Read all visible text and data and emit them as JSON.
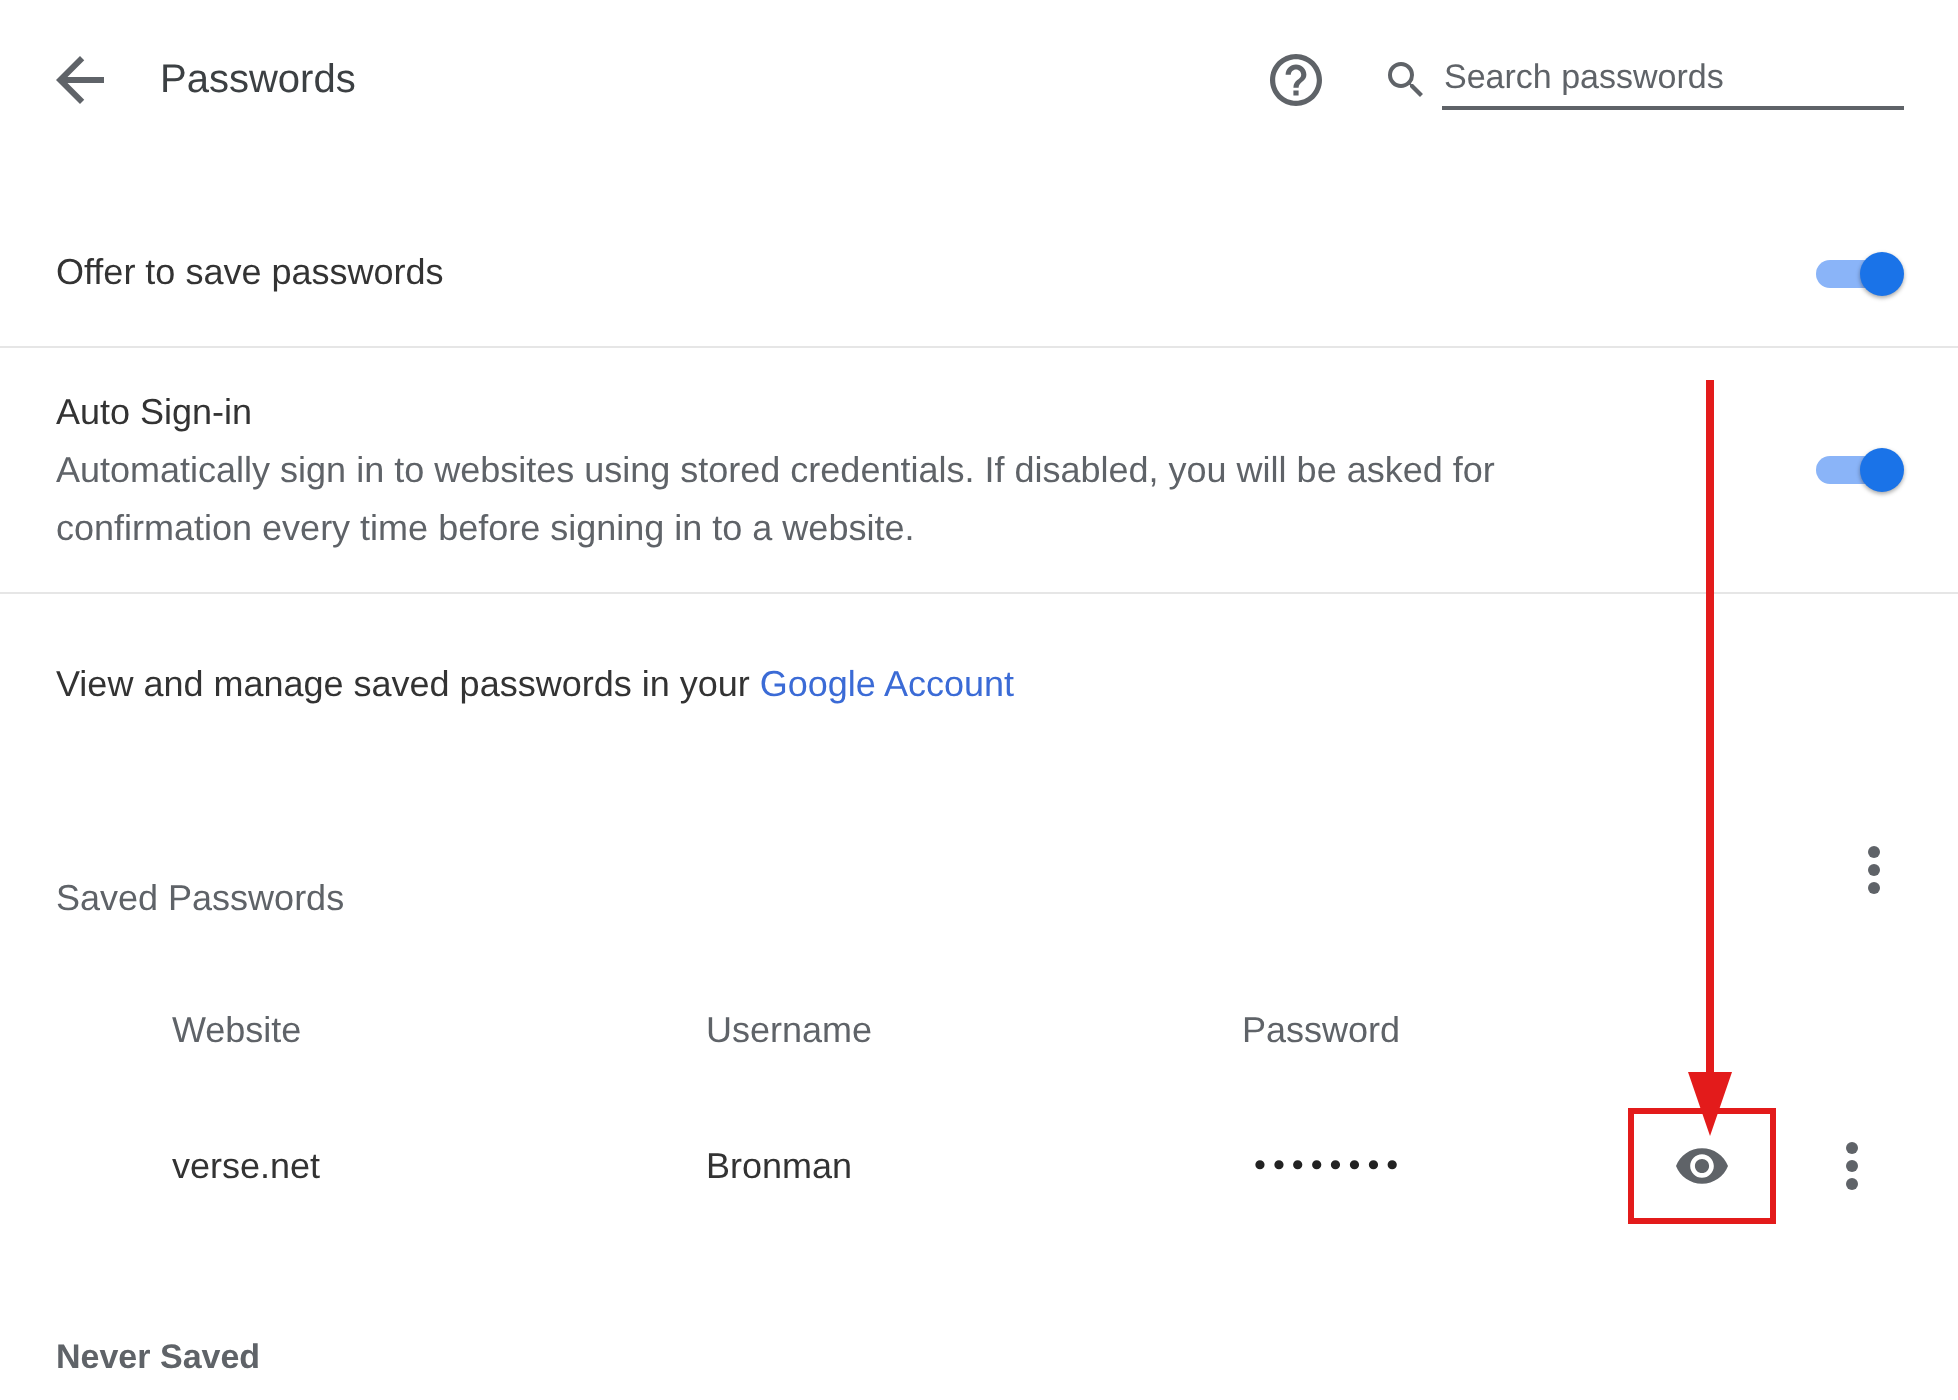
{
  "header": {
    "title": "Passwords",
    "search": {
      "placeholder": "Search passwords"
    }
  },
  "settings": [
    {
      "title": "Offer to save passwords",
      "on": true
    },
    {
      "title": "Auto Sign-in",
      "description": "Automatically sign in to websites using stored credentials. If disabled, you will be asked for confirmation every time before signing in to a website.",
      "on": true
    }
  ],
  "account_note": {
    "text": "View and manage saved passwords in your",
    "link": "Google Account"
  },
  "saved_passwords": {
    "title": "Saved Passwords",
    "columns": [
      "Website",
      "Username",
      "Password"
    ],
    "rows": [
      {
        "website": "verse.net",
        "username": "Bronman",
        "password": "••••••••"
      }
    ]
  },
  "never_saved": {
    "title": "Never Saved"
  }
}
